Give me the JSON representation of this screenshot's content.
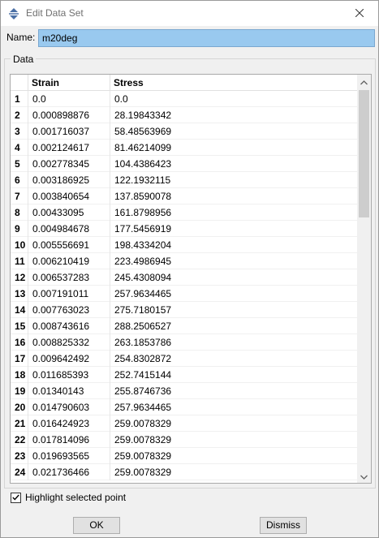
{
  "window": {
    "title": "Edit Data Set",
    "icon": "abaqus-app-icon"
  },
  "name_field": {
    "label": "Name:",
    "value": "m20deg"
  },
  "data_group": {
    "label": "Data"
  },
  "table": {
    "columns": [
      "Strain",
      "Stress"
    ],
    "rows": [
      {
        "idx": "1",
        "strain": "0.0",
        "stress": "0.0"
      },
      {
        "idx": "2",
        "strain": "0.000898876",
        "stress": "28.19843342"
      },
      {
        "idx": "3",
        "strain": "0.001716037",
        "stress": "58.48563969"
      },
      {
        "idx": "4",
        "strain": "0.002124617",
        "stress": "81.46214099"
      },
      {
        "idx": "5",
        "strain": "0.002778345",
        "stress": "104.4386423"
      },
      {
        "idx": "6",
        "strain": "0.003186925",
        "stress": "122.1932115"
      },
      {
        "idx": "7",
        "strain": "0.003840654",
        "stress": "137.8590078"
      },
      {
        "idx": "8",
        "strain": "0.00433095",
        "stress": "161.8798956"
      },
      {
        "idx": "9",
        "strain": "0.004984678",
        "stress": "177.5456919"
      },
      {
        "idx": "10",
        "strain": "0.005556691",
        "stress": "198.4334204"
      },
      {
        "idx": "11",
        "strain": "0.006210419",
        "stress": "223.4986945"
      },
      {
        "idx": "12",
        "strain": "0.006537283",
        "stress": "245.4308094"
      },
      {
        "idx": "13",
        "strain": "0.007191011",
        "stress": "257.9634465"
      },
      {
        "idx": "14",
        "strain": "0.007763023",
        "stress": "275.7180157"
      },
      {
        "idx": "15",
        "strain": "0.008743616",
        "stress": "288.2506527"
      },
      {
        "idx": "16",
        "strain": "0.008825332",
        "stress": "263.1853786"
      },
      {
        "idx": "17",
        "strain": "0.009642492",
        "stress": "254.8302872"
      },
      {
        "idx": "18",
        "strain": "0.011685393",
        "stress": "252.7415144"
      },
      {
        "idx": "19",
        "strain": "0.01340143",
        "stress": "255.8746736"
      },
      {
        "idx": "20",
        "strain": "0.014790603",
        "stress": "257.9634465"
      },
      {
        "idx": "21",
        "strain": "0.016424923",
        "stress": "259.0078329"
      },
      {
        "idx": "22",
        "strain": "0.017814096",
        "stress": "259.0078329"
      },
      {
        "idx": "23",
        "strain": "0.019693565",
        "stress": "259.0078329"
      },
      {
        "idx": "24",
        "strain": "0.021736466",
        "stress": "259.0078329"
      }
    ]
  },
  "highlight_checkbox": {
    "label": "Highlight selected point",
    "checked": true
  },
  "buttons": {
    "ok": "OK",
    "dismiss": "Dismiss"
  }
}
